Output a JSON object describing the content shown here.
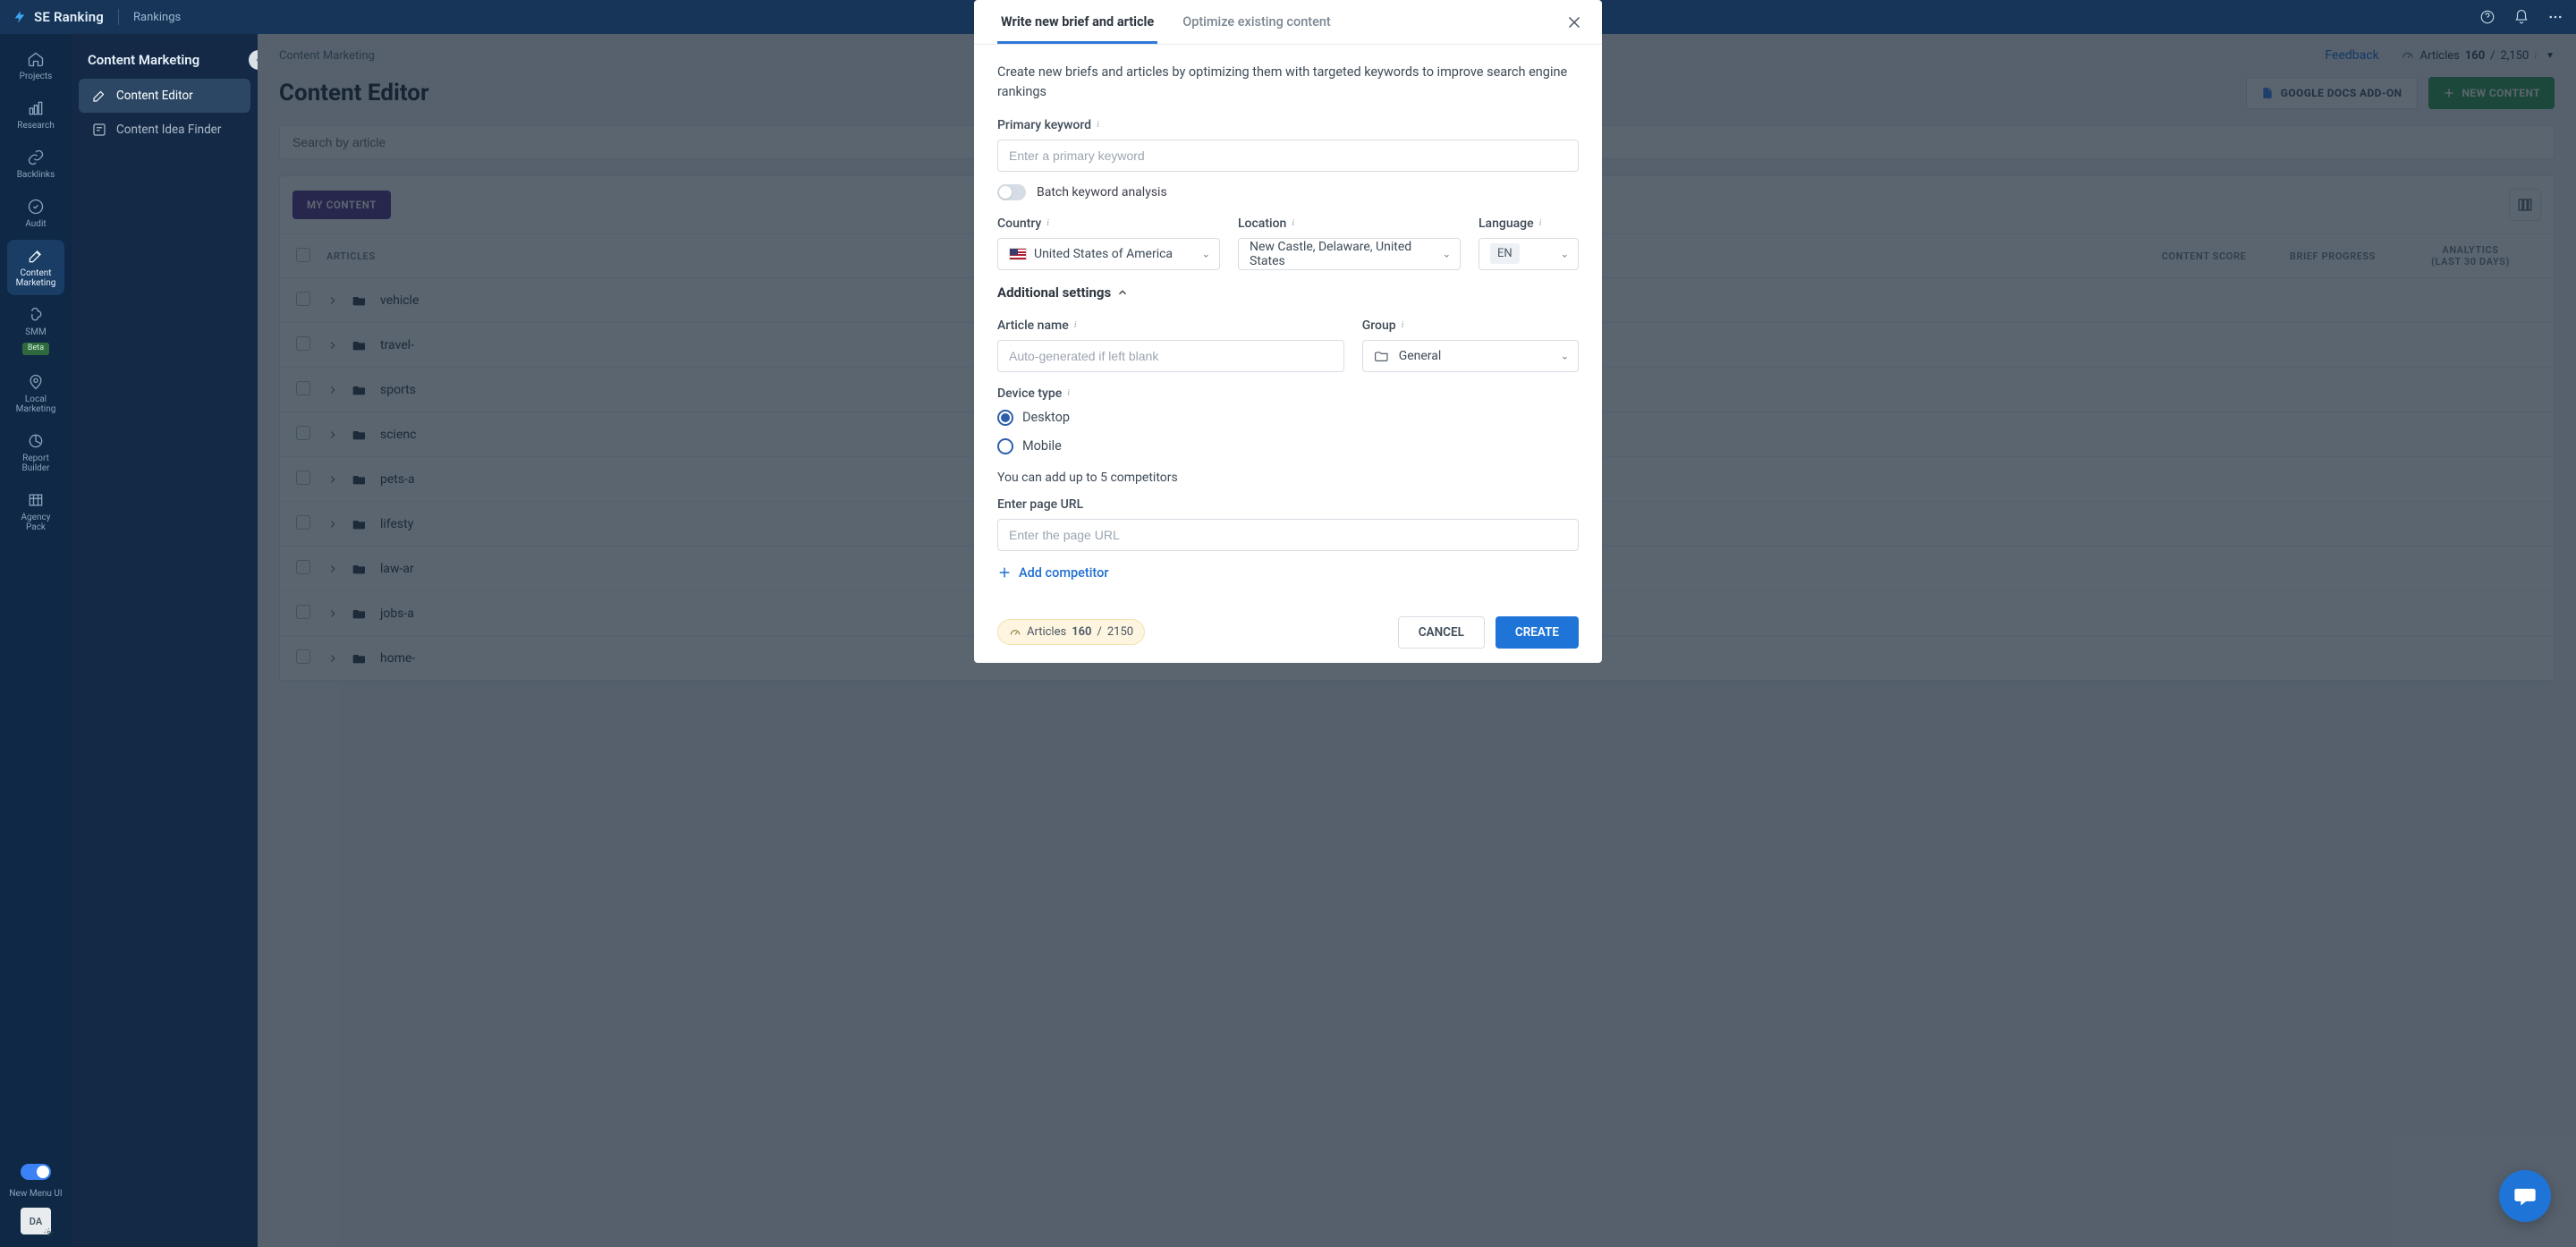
{
  "header": {
    "brand": "SE Ranking",
    "nav_item": "Rankings"
  },
  "rail": {
    "projects": "Projects",
    "research": "Research",
    "backlinks": "Backlinks",
    "audit": "Audit",
    "content_marketing_l1": "Content",
    "content_marketing_l2": "Marketing",
    "smm": "SMM",
    "smm_badge": "Beta",
    "local_l1": "Local",
    "local_l2": "Marketing",
    "report_l1": "Report",
    "report_l2": "Builder",
    "agency_l1": "Agency",
    "agency_l2": "Pack",
    "new_menu_ui": "New Menu UI",
    "da": "DA"
  },
  "subnav": {
    "title": "Content Marketing",
    "items": [
      {
        "label": "Content Editor"
      },
      {
        "label": "Content Idea Finder"
      }
    ]
  },
  "page": {
    "breadcrumb": "Content Marketing",
    "feedback": "Feedback",
    "quota_label": "Articles",
    "quota_used": "160",
    "quota_total": "2,150",
    "title": "Content Editor",
    "btn_gdocs": "GOOGLE DOCS ADD-ON",
    "btn_new": "NEW CONTENT",
    "search_placeholder": "Search by article",
    "tab_my": "MY CONTENT",
    "columns": {
      "articles": "ARTICLES",
      "score": "CONTENT SCORE",
      "brief": "BRIEF PROGRESS",
      "analytics_l1": "ANALYTICS",
      "analytics_l2": "(LAST 30 DAYS)"
    },
    "rows": [
      {
        "name": "vehicle"
      },
      {
        "name": "travel-"
      },
      {
        "name": "sports"
      },
      {
        "name": "scienc"
      },
      {
        "name": "pets-a"
      },
      {
        "name": "lifesty"
      },
      {
        "name": "law-ar"
      },
      {
        "name": "jobs-a"
      },
      {
        "name": "home-"
      }
    ]
  },
  "modal": {
    "tab_write": "Write new brief and article",
    "tab_optimize": "Optimize existing content",
    "description": "Create new briefs and articles by optimizing them with targeted keywords to improve search engine rankings",
    "primary_keyword_label": "Primary keyword",
    "primary_keyword_placeholder": "Enter a primary keyword",
    "batch_switch_label": "Batch keyword analysis",
    "country_label": "Country",
    "country_value": "United States of America",
    "location_label": "Location",
    "location_value": "New Castle, Delaware, United States",
    "language_label": "Language",
    "language_value": "EN",
    "additional_settings": "Additional settings",
    "article_name_label": "Article name",
    "article_name_placeholder": "Auto-generated if left blank",
    "group_label": "Group",
    "group_value": "General",
    "device_type_label": "Device type",
    "device_desktop": "Desktop",
    "device_mobile": "Mobile",
    "competitors_helper": "You can add up to 5 competitors",
    "page_url_label": "Enter page URL",
    "page_url_placeholder": "Enter the page URL",
    "add_competitor": "Add competitor",
    "footer_quota_label": "Articles",
    "footer_quota_used": "160",
    "footer_quota_sep": "/",
    "footer_quota_total": "2150",
    "cancel": "CANCEL",
    "create": "CREATE"
  }
}
